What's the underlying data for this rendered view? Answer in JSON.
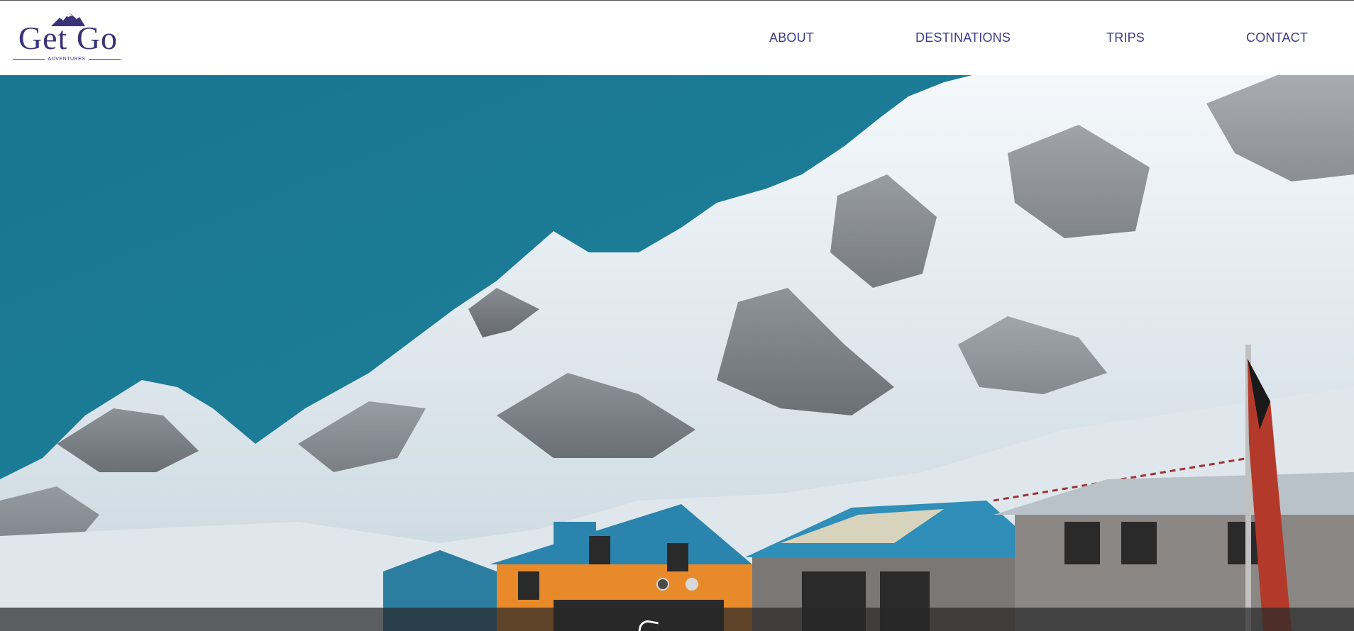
{
  "header": {
    "logo": {
      "main": "Get Go",
      "sub": "ADVENTURES",
      "icon": "mountain-icon"
    },
    "nav": [
      {
        "label": "ABOUT"
      },
      {
        "label": "DESTINATIONS"
      },
      {
        "label": "TRIPS"
      },
      {
        "label": "CONTACT"
      }
    ]
  },
  "hero": {
    "image": "mountain-village-photo",
    "carousel": {
      "slide_count": 2,
      "active_slide": 1
    }
  },
  "colors": {
    "brand": "#3a3378",
    "nav_text": "#3d3d86",
    "sky": "#197a93",
    "caption_bar": "#282828"
  }
}
